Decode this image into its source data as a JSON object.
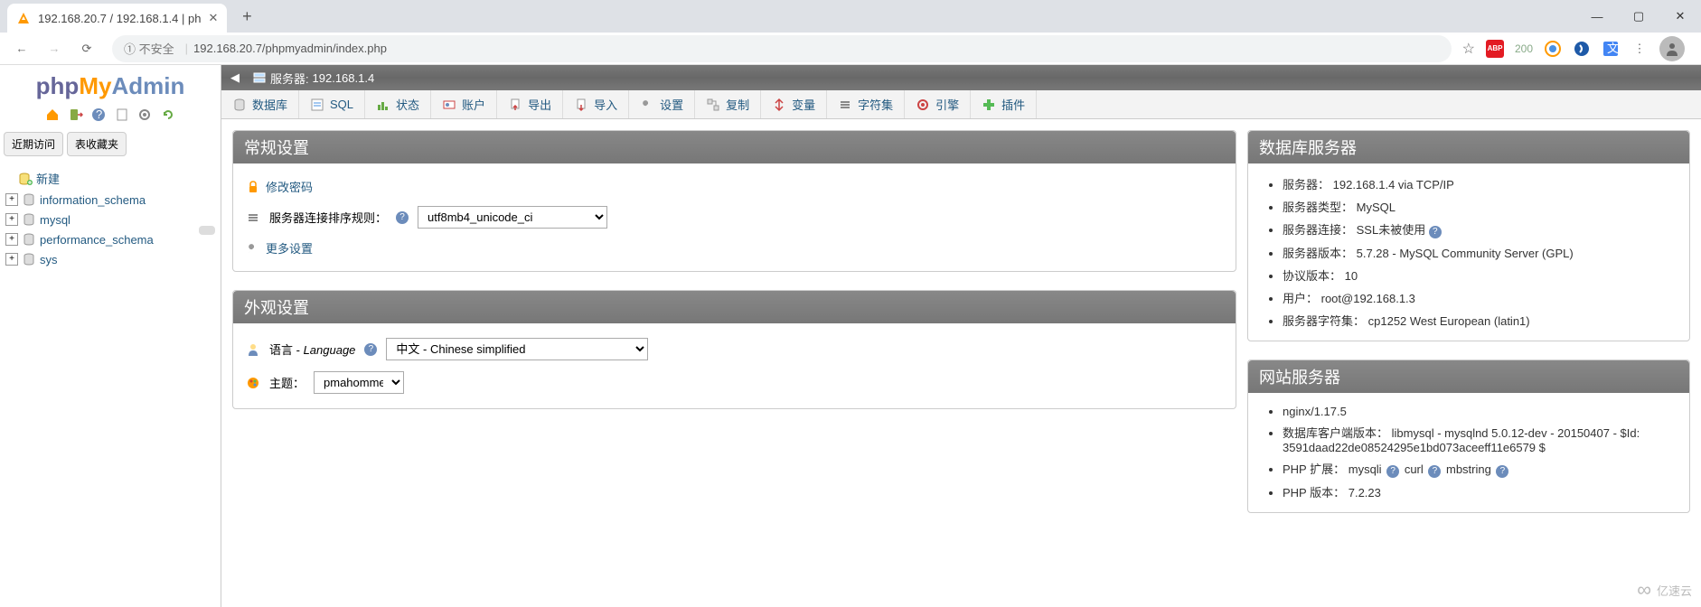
{
  "browser": {
    "tab_title": "192.168.20.7 / 192.168.1.4 | ph",
    "url_security": "① 不安全",
    "url": "192.168.20.7/phpmyadmin/index.php",
    "ext_count": "200"
  },
  "logo": {
    "php": "php",
    "my": "My",
    "admin": "Admin"
  },
  "sidebar": {
    "tabs": [
      "近期访问",
      "表收藏夹"
    ],
    "new_label": "新建",
    "databases": [
      "information_schema",
      "mysql",
      "performance_schema",
      "sys"
    ]
  },
  "breadcrumb": {
    "prefix": "服务器:",
    "server": "192.168.1.4"
  },
  "topmenu": [
    "数据库",
    "SQL",
    "状态",
    "账户",
    "导出",
    "导入",
    "设置",
    "复制",
    "变量",
    "字符集",
    "引擎",
    "插件"
  ],
  "general": {
    "heading": "常规设置",
    "change_pw": "修改密码",
    "collation_label": "服务器连接排序规则：",
    "collation_value": "utf8mb4_unicode_ci",
    "more": "更多设置"
  },
  "appearance": {
    "heading": "外观设置",
    "lang_label": "语言 - ",
    "lang_label_en": "Language",
    "lang_value": "中文 - Chinese simplified",
    "theme_label": "主题：",
    "theme_value": "pmahomme"
  },
  "dbserver": {
    "heading": "数据库服务器",
    "items": [
      {
        "k": "服务器：",
        "v": "192.168.1.4 via TCP/IP"
      },
      {
        "k": "服务器类型：",
        "v": "MySQL"
      },
      {
        "k": "服务器连接：",
        "v": "SSL未被使用",
        "red": true,
        "help": true
      },
      {
        "k": "服务器版本：",
        "v": "5.7.28 - MySQL Community Server (GPL)"
      },
      {
        "k": "协议版本：",
        "v": "10"
      },
      {
        "k": "用户：",
        "v": "root@192.168.1.3"
      },
      {
        "k": "服务器字符集：",
        "v": "cp1252 West European (latin1)"
      }
    ]
  },
  "webserver": {
    "heading": "网站服务器",
    "items": [
      {
        "v": "nginx/1.17.5"
      },
      {
        "k": "数据库客户端版本：",
        "v": "libmysql - mysqlnd 5.0.12-dev - 20150407 - $Id: 3591daad22de08524295e1bd073aceeff11e6579 $"
      },
      {
        "k": "PHP 扩展：",
        "v": "mysqli",
        "ext": [
          "curl",
          "mbstring"
        ],
        "help": true
      },
      {
        "k": "PHP 版本：",
        "v": "7.2.23"
      }
    ]
  },
  "watermark": "亿速云"
}
